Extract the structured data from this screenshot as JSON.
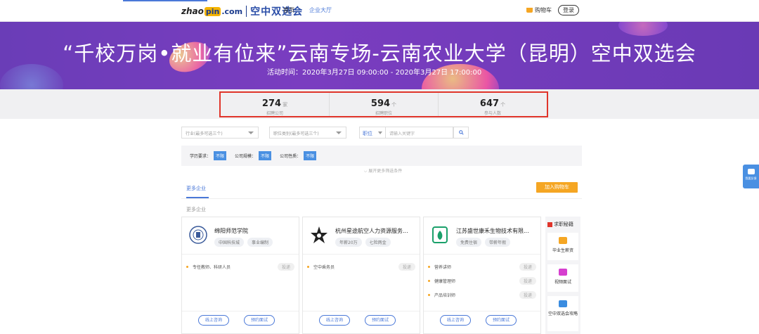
{
  "header": {
    "logo_zhao": "zhao",
    "logo_pin": "pin",
    "logo_com": ".com",
    "logo_sub": "空中双选会",
    "nav_home": "首页",
    "nav_hall": "企业大厅",
    "cart": "购物车",
    "login": "登录"
  },
  "banner": {
    "title": "“千校万岗•就业有位来”云南专场-云南农业大学（昆明）空中双选会",
    "time": "活动时间：2020年3月27日 09:00:00 - 2020年3月27日 17:00:00"
  },
  "stats": [
    {
      "num": "274",
      "unit": "家",
      "label": "招聘公司"
    },
    {
      "num": "594",
      "unit": "个",
      "label": "招聘职位"
    },
    {
      "num": "647",
      "unit": "个",
      "label": "参与人数"
    }
  ],
  "filters": {
    "industry_placeholder": "行业(最多可选三个)",
    "category_placeholder": "职位类别(最多可选三个)",
    "keyword_type": "职位",
    "keyword_placeholder": "请输入关键字",
    "education_label": "学历要求：",
    "scale_label": "公司规模：",
    "nature_label": "公司性质：",
    "unlimited": "不限",
    "more": "展开更多筛选条件"
  },
  "tabs": {
    "active": "更多企业",
    "add_cart": "加入购物车",
    "section": "更多企业"
  },
  "cards": [
    {
      "name": "绵阳师范学院",
      "chips": [
        "中国科技城",
        "事业编制"
      ],
      "jobs": [
        "专任教师、科研人员"
      ],
      "btn_consult": "线上咨询",
      "btn_interview": "预约面试"
    },
    {
      "name": "杭州星途航空人力资源服务...",
      "chips": [
        "年薪20万",
        "七险两金"
      ],
      "jobs": [
        "空中乘务员"
      ],
      "btn_consult": "线上咨询",
      "btn_interview": "预约面试"
    },
    {
      "name": "江苏盛世康禾生物技术有限...",
      "chips": [
        "免费住宿",
        "带薪年假"
      ],
      "jobs": [
        "营养讲师",
        "健康管理师",
        "产品培训师"
      ],
      "btn_consult": "线上咨询",
      "btn_interview": "预约面试"
    }
  ],
  "deliver": "投递",
  "side": {
    "title": "求职秘籍",
    "items": [
      "毕业生薪资",
      "视频面试",
      "空中双选会攻略"
    ]
  },
  "feedback": "我要反馈",
  "colors": {
    "accent": "#4a78d8",
    "banner": "#6a3db7",
    "highlight_border": "#e0352b",
    "orange": "#f5a623"
  }
}
